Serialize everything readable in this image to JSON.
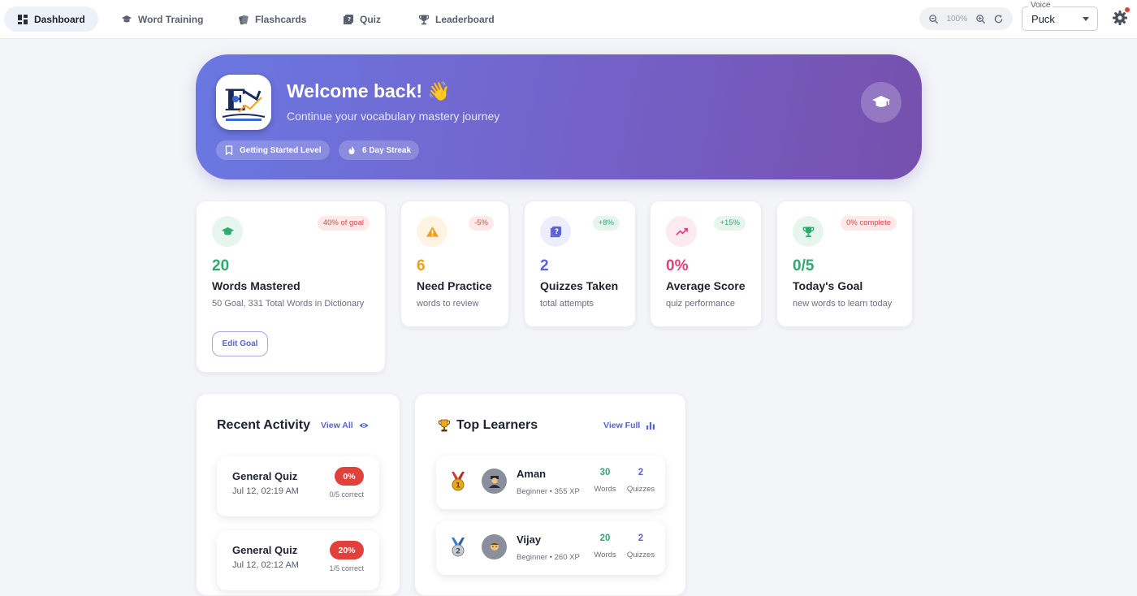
{
  "nav": {
    "items": [
      {
        "label": "Dashboard",
        "icon": "dashboard-icon",
        "active": true
      },
      {
        "label": "Word Training",
        "icon": "graduation-cap-icon",
        "active": false
      },
      {
        "label": "Flashcards",
        "icon": "flashcards-icon",
        "active": false
      },
      {
        "label": "Quiz",
        "icon": "quiz-icon",
        "active": false
      },
      {
        "label": "Leaderboard",
        "icon": "trophy-icon",
        "active": false
      }
    ],
    "zoom": "100%",
    "voice": {
      "legend": "Voice",
      "value": "Puck"
    }
  },
  "hero": {
    "title": "Welcome back! 👋",
    "subtitle": "Continue your vocabulary mastery journey",
    "chips": [
      "Getting Started Level",
      "6 Day Streak"
    ]
  },
  "stats": [
    {
      "value": "20",
      "label": "Words Mastered",
      "desc": "50 Goal, 331 Total Words in Dictionary",
      "badge": "40% of goal",
      "color": "#2eaa6e",
      "action": "Edit Goal"
    },
    {
      "value": "6",
      "label": "Need Practice",
      "desc": "words to review",
      "badge": "-5%",
      "color": "#f0a020"
    },
    {
      "value": "2",
      "label": "Quizzes Taken",
      "desc": "total attempts",
      "badge": "+8%",
      "color": "#5a62d6"
    },
    {
      "value": "0%",
      "label": "Average Score",
      "desc": "quiz performance",
      "badge": "+15%",
      "color": "#e2407c"
    },
    {
      "value": "0/5",
      "label": "Today's Goal",
      "desc": "new words to learn today",
      "badge": "0% complete",
      "color": "#2eaa6e"
    }
  ],
  "activity": {
    "title": "Recent Activity",
    "link": "View All",
    "items": [
      {
        "name": "General Quiz",
        "date": "Jul 12, 02:19 AM",
        "score": "0%",
        "correct": "0/5 correct"
      },
      {
        "name": "General Quiz",
        "date": "Jul 12, 02:12 AM",
        "score": "20%",
        "correct": "1/5 correct"
      }
    ]
  },
  "learners": {
    "title": "Top Learners",
    "link": "View Full",
    "items": [
      {
        "name": "Aman",
        "meta": "Beginner • 355 XP",
        "words": "30",
        "quizzes": "2",
        "words_label": "Words",
        "quizzes_label": "Quizzes"
      },
      {
        "name": "Vijay",
        "meta": "Beginner • 260 XP",
        "words": "20",
        "quizzes": "2",
        "words_label": "Words",
        "quizzes_label": "Quizzes"
      }
    ]
  }
}
